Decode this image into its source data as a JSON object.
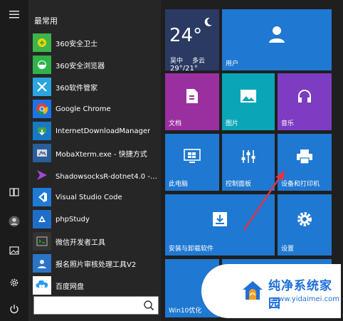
{
  "rail": {
    "items": [
      {
        "name": "menu-icon"
      },
      {
        "name": "tablet-mode-icon"
      },
      {
        "name": "user-icon"
      },
      {
        "name": "pictures-icon"
      },
      {
        "name": "gear-icon"
      },
      {
        "name": "power-icon"
      }
    ]
  },
  "applist": {
    "header": "最常用",
    "apps": [
      {
        "label": "360安全卫士",
        "icon": "360-safeguard-icon",
        "color": "#3db54a"
      },
      {
        "label": "360安全浏览器",
        "icon": "360-browser-icon",
        "color": "#2fb24a"
      },
      {
        "label": "360软件管家",
        "icon": "360-software-manager-icon",
        "color": "#2aa5df"
      },
      {
        "label": "Google Chrome",
        "icon": "chrome-icon",
        "color": "#1a73e8"
      },
      {
        "label": "InternetDownloadManager",
        "icon": "idm-icon",
        "color": "#1778c3"
      },
      {
        "label": "MobaXterm.exe - 快捷方式",
        "icon": "mobaxterm-icon",
        "color": "#2a5d9b"
      },
      {
        "label": "ShadowsocksR-dotnet4.0 - 快...",
        "icon": "shadowsocks-icon",
        "color": "#7a3cc2"
      },
      {
        "label": "Visual Studio Code",
        "icon": "vscode-icon",
        "color": "#1f7ad6"
      },
      {
        "label": "phpStudy",
        "icon": "phpstudy-icon",
        "color": "#1e6ec8"
      },
      {
        "label": "微信开发者工具",
        "icon": "wechat-devtools-icon",
        "color": "#333333"
      },
      {
        "label": "报名照片审核处理工具V2",
        "icon": "photo-tool-icon",
        "color": "#2b73c6"
      },
      {
        "label": "百度网盘",
        "icon": "baidu-netdisk-icon",
        "color": "#1a8fe8"
      }
    ]
  },
  "weather": {
    "temp": "24°",
    "city": "吴中",
    "desc": "多云",
    "range": "29°/21°"
  },
  "tiles": {
    "user": "用户",
    "documents": "文档",
    "pictures": "图片",
    "music": "音乐",
    "this_pc": "此电脑",
    "control_panel": "控制面板",
    "devices_printers": "设备和打印机",
    "install_uninstall": "安装与卸载软件",
    "settings": "设置",
    "win10": "Win10优化"
  },
  "watermark": {
    "title": "纯净系统家园",
    "url": "www.yidaimei.com"
  },
  "colors": {
    "tile_blue": "#1f78d1",
    "tile_purple": "#9a2fa0",
    "tile_teal": "#0aa6b8",
    "tile_violet": "#7e3cc2",
    "tile_dark": "#2a65a7",
    "arrow_red": "#e8333f"
  }
}
